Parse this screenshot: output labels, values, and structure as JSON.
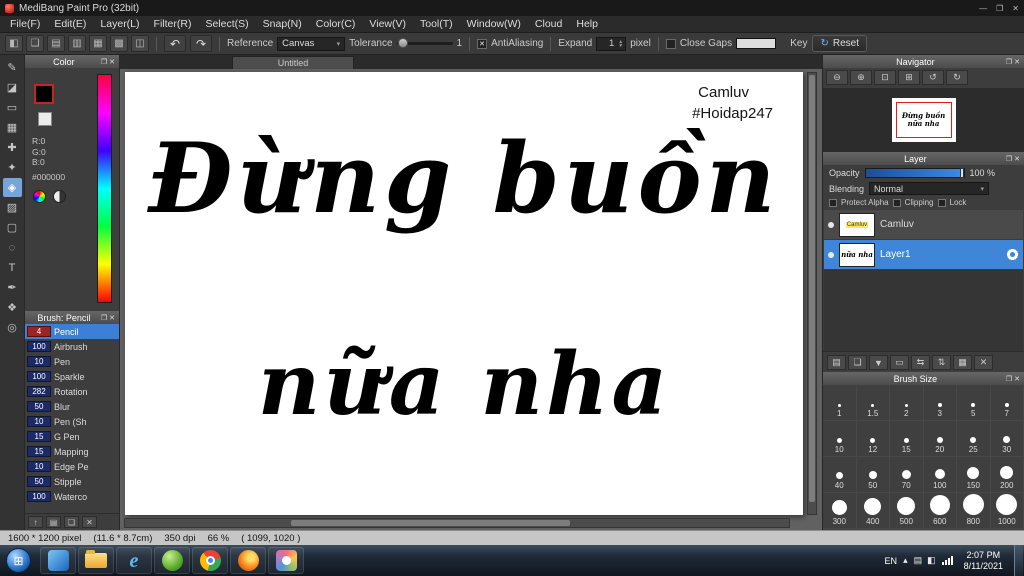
{
  "titlebar": {
    "title": "MediBang Paint Pro (32bit)",
    "minimize": "—",
    "maximize": "❐",
    "close": "✕"
  },
  "menubar": {
    "items": [
      "File(F)",
      "Edit(E)",
      "Layer(L)",
      "Filter(R)",
      "Select(S)",
      "Snap(N)",
      "Color(C)",
      "View(V)",
      "Tool(T)",
      "Window(W)",
      "Cloud",
      "Help"
    ]
  },
  "toolbar": {
    "icons": [
      {
        "name": "bucket-options-icon",
        "glyph": "◧"
      },
      {
        "name": "export-icon",
        "glyph": "❏"
      },
      {
        "name": "publish-icon",
        "glyph": "▤"
      },
      {
        "name": "comment-icon",
        "glyph": "▥"
      },
      {
        "name": "snap-grid-icon",
        "glyph": "▦"
      },
      {
        "name": "material-panel-icon",
        "glyph": "▩"
      },
      {
        "name": "panel-layout-icon",
        "glyph": "◫"
      }
    ],
    "undo": "↶",
    "redo": "↷",
    "reference_label": "Reference",
    "reference_value": "Canvas",
    "tolerance_label": "Tolerance",
    "tolerance_value": "1",
    "antialiasing_label": "AntiAliasing",
    "antialiasing_mark": "✕",
    "expand_label": "Expand",
    "expand_value": "1",
    "expand_unit": "pixel",
    "close_gaps_label": "Close Gaps",
    "key_label": "Key",
    "reset_glyph": "↻",
    "reset_label": "Reset"
  },
  "tools": [
    {
      "name": "pen-tool",
      "glyph": "✎",
      "selected": false
    },
    {
      "name": "eraser-tool",
      "glyph": "◪",
      "selected": false
    },
    {
      "name": "select-rect-tool",
      "glyph": "▭",
      "selected": false
    },
    {
      "name": "transform-tool",
      "glyph": "▦",
      "selected": false
    },
    {
      "name": "move-tool",
      "glyph": "✚",
      "selected": false
    },
    {
      "name": "magic-wand-tool",
      "glyph": "✦",
      "selected": false
    },
    {
      "name": "bucket-fill-tool",
      "glyph": "◈",
      "selected": true
    },
    {
      "name": "gradient-tool",
      "glyph": "▨",
      "selected": false
    },
    {
      "name": "marquee-tool",
      "glyph": "▢",
      "selected": false
    },
    {
      "name": "lasso-tool",
      "glyph": "◌",
      "selected": false
    },
    {
      "name": "text-tool",
      "glyph": "T",
      "selected": false
    },
    {
      "name": "eyedropper-tool",
      "glyph": "✒",
      "selected": false
    },
    {
      "name": "hand-tool",
      "glyph": "❖",
      "selected": false
    },
    {
      "name": "zoom-tool",
      "glyph": "◎",
      "selected": false
    }
  ],
  "color_panel": {
    "title": "Color",
    "r": "R:0",
    "g": "G:0",
    "b": "B:0",
    "hex": "#000000"
  },
  "brush_panel": {
    "title": "Brush: Pencil",
    "brushes": [
      {
        "size": "4",
        "name": "Pencil",
        "selected": true
      },
      {
        "size": "100",
        "name": "Airbrush",
        "selected": false
      },
      {
        "size": "10",
        "name": "Pen",
        "selected": false
      },
      {
        "size": "100",
        "name": "Sparkle",
        "selected": false
      },
      {
        "size": "282",
        "name": "Rotation",
        "selected": false
      },
      {
        "size": "50",
        "name": "Blur",
        "selected": false
      },
      {
        "size": "10",
        "name": "Pen (Sh",
        "selected": false
      },
      {
        "size": "15",
        "name": "G Pen",
        "selected": false
      },
      {
        "size": "15",
        "name": "Mapping",
        "selected": false
      },
      {
        "size": "10",
        "name": "Edge Pe",
        "selected": false
      },
      {
        "size": "50",
        "name": "Stipple",
        "selected": false
      },
      {
        "size": "100",
        "name": "Waterco",
        "selected": false
      }
    ],
    "actions": [
      {
        "name": "brush-up-icon",
        "glyph": "↑"
      },
      {
        "name": "brush-add-icon",
        "glyph": "▤"
      },
      {
        "name": "brush-duplicate-icon",
        "glyph": "❏"
      },
      {
        "name": "brush-delete-icon",
        "glyph": "✕"
      }
    ]
  },
  "canvas": {
    "tab": "Untitled",
    "signature": "Camluv",
    "hashtag": "#Hoidap247",
    "line1": "Đừng buồn",
    "line2": "nữa nha"
  },
  "navigator": {
    "title": "Navigator",
    "buttons": [
      {
        "name": "zoom-out-icon",
        "glyph": "⊖"
      },
      {
        "name": "zoom-in-icon",
        "glyph": "⊕"
      },
      {
        "name": "fit-window-icon",
        "glyph": "⊡"
      },
      {
        "name": "actual-size-icon",
        "glyph": "⊞"
      },
      {
        "name": "rotate-left-icon",
        "glyph": "↺"
      },
      {
        "name": "rotate-right-icon",
        "glyph": "↻"
      }
    ]
  },
  "layer_panel": {
    "title": "Layer",
    "opacity_label": "Opacity",
    "opacity_value": "100 %",
    "blending_label": "Blending",
    "blending_value": "Normal",
    "protect_alpha_label": "Protect Alpha",
    "clipping_label": "Clipping",
    "lock_label": "Lock",
    "layers": [
      {
        "name": "Camluv",
        "selected": false
      },
      {
        "name": "Layer1",
        "selected": true
      }
    ],
    "actions": [
      {
        "name": "new-layer-icon",
        "glyph": "▤"
      },
      {
        "name": "duplicate-layer-icon",
        "glyph": "❏"
      },
      {
        "name": "merge-down-icon",
        "glyph": "▼"
      },
      {
        "name": "new-folder-icon",
        "glyph": "▭"
      },
      {
        "name": "transfer-layer-icon",
        "glyph": "⇆"
      },
      {
        "name": "order-layer-icon",
        "glyph": "⇅"
      },
      {
        "name": "combine-layer-icon",
        "glyph": "▦"
      },
      {
        "name": "delete-layer-icon",
        "glyph": "✕"
      }
    ]
  },
  "brush_size_panel": {
    "title": "Brush Size",
    "sizes": [
      1,
      1.5,
      2,
      3,
      5,
      7,
      10,
      12,
      15,
      20,
      25,
      30,
      40,
      50,
      70,
      100,
      150,
      200,
      300,
      400,
      500,
      600,
      800,
      1000
    ]
  },
  "statusbar": {
    "size": "1600 * 1200 pixel",
    "dimensions": "(11.6 * 8.7cm)",
    "dpi": "350 dpi",
    "zoom": "66 %",
    "coords": "( 1099, 1020 )"
  },
  "taskbar": {
    "start_glyph": "⊞",
    "apps": [
      {
        "name": "blue-app-icon",
        "cls": "blue-app"
      },
      {
        "name": "explorer-icon",
        "cls": "explorer"
      },
      {
        "name": "internet-explorer-icon",
        "cls": "internet-explorer",
        "text": "e"
      },
      {
        "name": "green-app-icon",
        "cls": "green-app"
      },
      {
        "name": "chrome-icon",
        "cls": "chrome"
      },
      {
        "name": "firefox-icon",
        "cls": "firefox"
      },
      {
        "name": "medibang-icon",
        "cls": "medibang"
      }
    ],
    "lang": "EN",
    "tray_expand": "▴",
    "tray_icons": [
      {
        "name": "action-center-icon",
        "glyph": "▤"
      },
      {
        "name": "power-icon",
        "glyph": "◧"
      }
    ],
    "time": "2:07 PM",
    "date": "8/11/2021"
  }
}
